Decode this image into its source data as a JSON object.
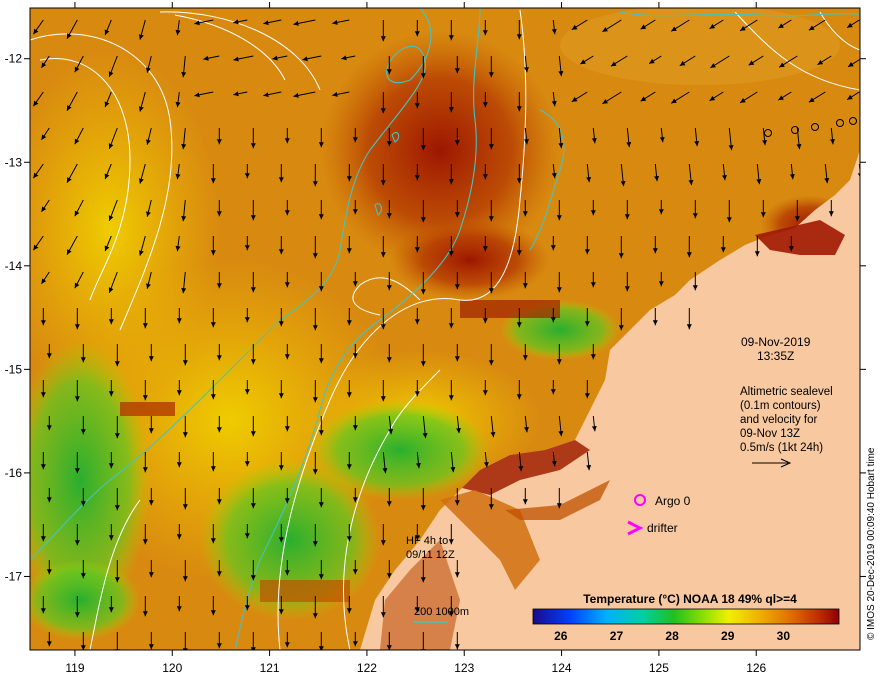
{
  "map": {
    "lon_ticks": [
      "119",
      "120",
      "121",
      "122",
      "123",
      "124",
      "125",
      "126"
    ],
    "lat_ticks": [
      "-12",
      "-13",
      "-14",
      "-15",
      "-16",
      "-17"
    ],
    "lon_range": [
      118.6,
      127.0
    ],
    "lat_range": [
      -18.0,
      -11.8
    ]
  },
  "annotations": {
    "date": "09-Nov-2019",
    "time": "13:35Z",
    "altimetry_line1": "Altimetric sealevel",
    "altimetry_line2": "(0.1m contours)",
    "altimetry_line3": "and velocity for",
    "altimetry_line4": "09-Nov 13Z",
    "altimetry_line5": "0.5m/s (1kt 24h)",
    "argo_label": "Argo 0",
    "drifter_label": "drifter",
    "note_line1": "HF 4h to",
    "note_line2": "09/11 12Z",
    "bathymetry_label": "200  1000m",
    "credit": "© IMOS 20-Dec-2019 00:09:40 Hobart time"
  },
  "colorbar": {
    "title": "Temperature (°C) NOAA 18 49% ql>=4",
    "ticks": [
      "26",
      "27",
      "28",
      "29",
      "30"
    ],
    "range": [
      25.5,
      31
    ]
  },
  "colors": {
    "land": "#f8c9a0",
    "contour_isobath": "#46c3c0",
    "sealevel_contour": "#ffffff",
    "argo_marker": "#ff00ff",
    "drifter_marker": "#ff00ff",
    "arrow": "#000000"
  }
}
